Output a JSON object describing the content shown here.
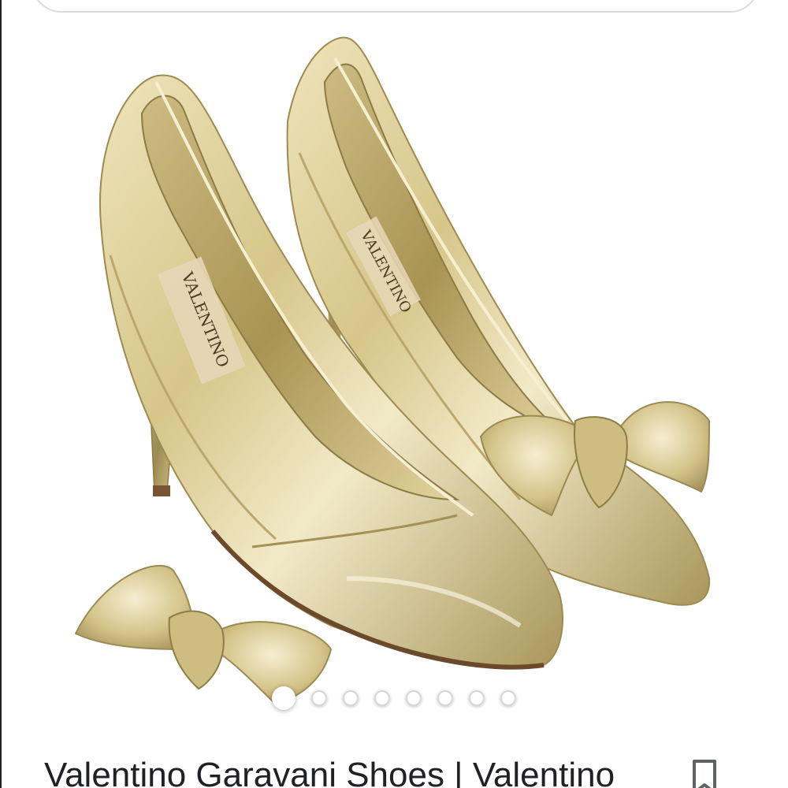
{
  "result": {
    "title": "Valentino Garavani Shoes | Valentino"
  },
  "carousel": {
    "dot_count": 8,
    "active_index": 0
  },
  "image": {
    "label": "VALENTINO",
    "colors": {
      "metal_gold": "#d8c98f",
      "metal_highlight": "#f4eccb",
      "metal_shadow": "#9a8a52",
      "insole": "#b9a46c",
      "outsole": "#6b4a2c"
    }
  },
  "icons": {
    "save": "bookmark-icon"
  }
}
